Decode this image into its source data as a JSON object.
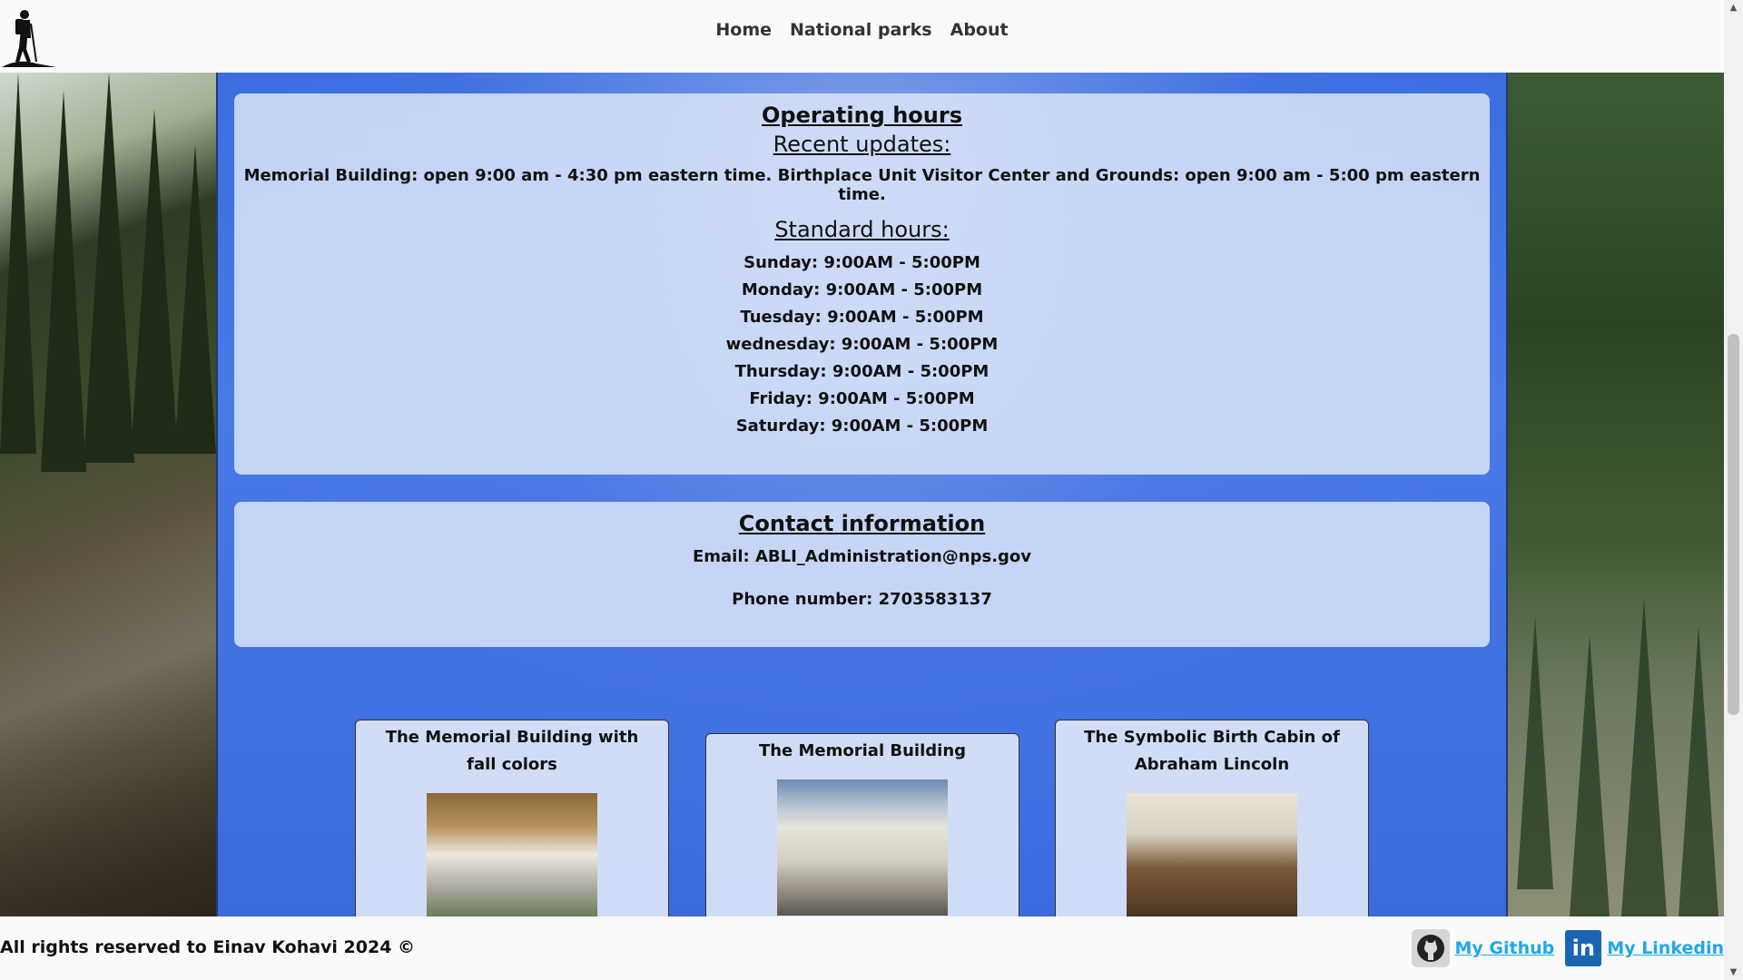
{
  "nav": {
    "items": [
      "Home",
      "National parks",
      "About"
    ]
  },
  "hours": {
    "title": "Operating hours",
    "recent_label": "Recent updates:",
    "recent_text": "Memorial Building: open 9:00 am - 4:30 pm eastern time. Birthplace Unit Visitor Center and Grounds: open 9:00 am - 5:00 pm eastern time.",
    "standard_label": "Standard hours:",
    "days": [
      "Sunday: 9:00AM - 5:00PM",
      "Monday: 9:00AM - 5:00PM",
      "Tuesday: 9:00AM - 5:00PM",
      "wednesday: 9:00AM - 5:00PM",
      "Thursday: 9:00AM - 5:00PM",
      "Friday: 9:00AM - 5:00PM",
      "Saturday: 9:00AM - 5:00PM"
    ]
  },
  "contact": {
    "title": "Contact information",
    "email": "Email: ABLI_Administration@nps.gov",
    "phone": "Phone number: 2703583137"
  },
  "gallery": {
    "cards": [
      {
        "title": "The Memorial Building with fall colors"
      },
      {
        "title": "The Memorial Building"
      },
      {
        "title": "The Symbolic Birth Cabin of Abraham Lincoln"
      }
    ]
  },
  "footer": {
    "copyright": "All rights reserved to Einav Kohavi 2024 ©",
    "github_label": "My Github",
    "linkedin_label": "My Linkedin",
    "linkedin_icon_text": "in"
  },
  "icons": {
    "logo": "hiker-icon",
    "github": "github-icon",
    "linkedin": "linkedin-icon"
  },
  "colors": {
    "panel_bg": "#e1e9fa",
    "center_bg": "#3b6de0",
    "link": "#1ea7ef",
    "linkedin": "#1a66b3"
  }
}
